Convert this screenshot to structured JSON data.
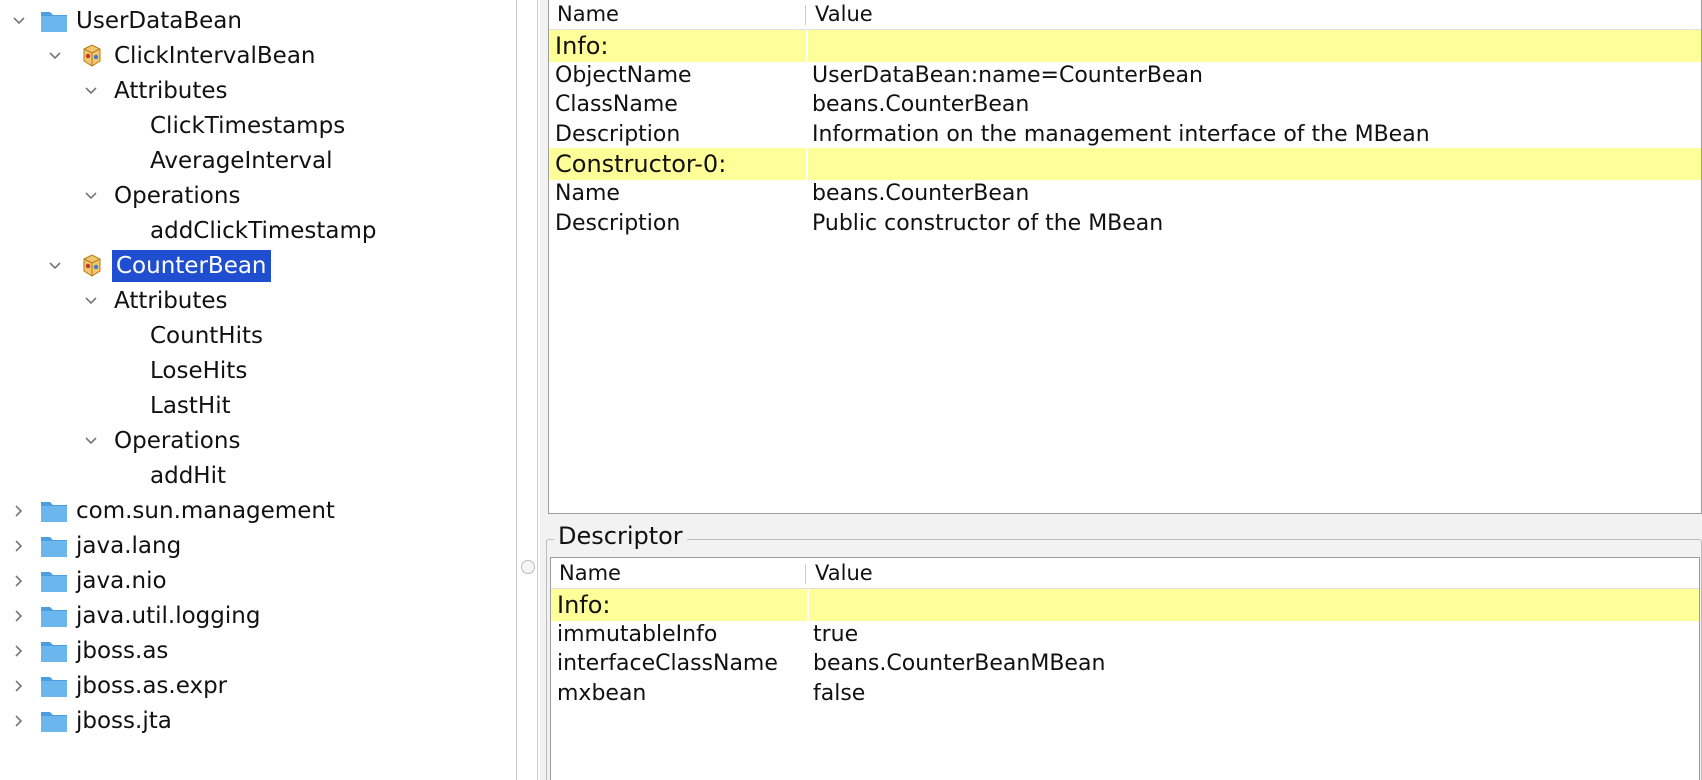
{
  "tree": {
    "items": [
      {
        "label": "UserDataBean",
        "icon": "folder-icon",
        "chevron": "expanded"
      },
      {
        "label": "ClickIntervalBean",
        "icon": "bean-icon",
        "chevron": "expanded"
      },
      {
        "label": "Attributes",
        "chevron": "expanded"
      },
      {
        "label": "ClickTimestamps"
      },
      {
        "label": "AverageInterval"
      },
      {
        "label": "Operations",
        "chevron": "expanded"
      },
      {
        "label": "addClickTimestamp"
      },
      {
        "label": "CounterBean",
        "icon": "bean-icon",
        "chevron": "expanded",
        "selected": true
      },
      {
        "label": "Attributes",
        "chevron": "expanded"
      },
      {
        "label": "CountHits"
      },
      {
        "label": "LoseHits"
      },
      {
        "label": "LastHit"
      },
      {
        "label": "Operations",
        "chevron": "expanded"
      },
      {
        "label": "addHit"
      },
      {
        "label": "com.sun.management",
        "icon": "folder-icon",
        "chevron": "collapsed"
      },
      {
        "label": "java.lang",
        "icon": "folder-icon",
        "chevron": "collapsed"
      },
      {
        "label": "java.nio",
        "icon": "folder-icon",
        "chevron": "collapsed"
      },
      {
        "label": "java.util.logging",
        "icon": "folder-icon",
        "chevron": "collapsed"
      },
      {
        "label": "jboss.as",
        "icon": "folder-icon",
        "chevron": "collapsed"
      },
      {
        "label": "jboss.as.expr",
        "icon": "folder-icon",
        "chevron": "collapsed"
      },
      {
        "label": "jboss.jta",
        "icon": "folder-icon",
        "chevron": "collapsed"
      }
    ]
  },
  "info_table": {
    "headers": {
      "name": "Name",
      "value": "Value"
    },
    "rows": [
      {
        "type": "section",
        "name": "Info:",
        "value": ""
      },
      {
        "type": "row",
        "name": "ObjectName",
        "value": "UserDataBean:name=CounterBean"
      },
      {
        "type": "row",
        "name": "ClassName",
        "value": "beans.CounterBean"
      },
      {
        "type": "row",
        "name": "Description",
        "value": "Information on the management interface of the MBean"
      },
      {
        "type": "section",
        "name": "Constructor-0:",
        "value": ""
      },
      {
        "type": "row",
        "name": "Name",
        "value": "beans.CounterBean"
      },
      {
        "type": "row",
        "name": "Description",
        "value": "Public constructor of the MBean"
      }
    ]
  },
  "descriptor": {
    "title": "Descriptor",
    "headers": {
      "name": "Name",
      "value": "Value"
    },
    "rows": [
      {
        "type": "section",
        "name": "Info:",
        "value": ""
      },
      {
        "type": "row",
        "name": "immutableInfo",
        "value": "true"
      },
      {
        "type": "row",
        "name": "interfaceClassName",
        "value": "beans.CounterBeanMBean"
      },
      {
        "type": "row",
        "name": "mxbean",
        "value": "false"
      }
    ]
  },
  "colors": {
    "selection": "#1f4fd0",
    "section_highlight": "#ffff99",
    "folder": "#5aa9e6"
  }
}
